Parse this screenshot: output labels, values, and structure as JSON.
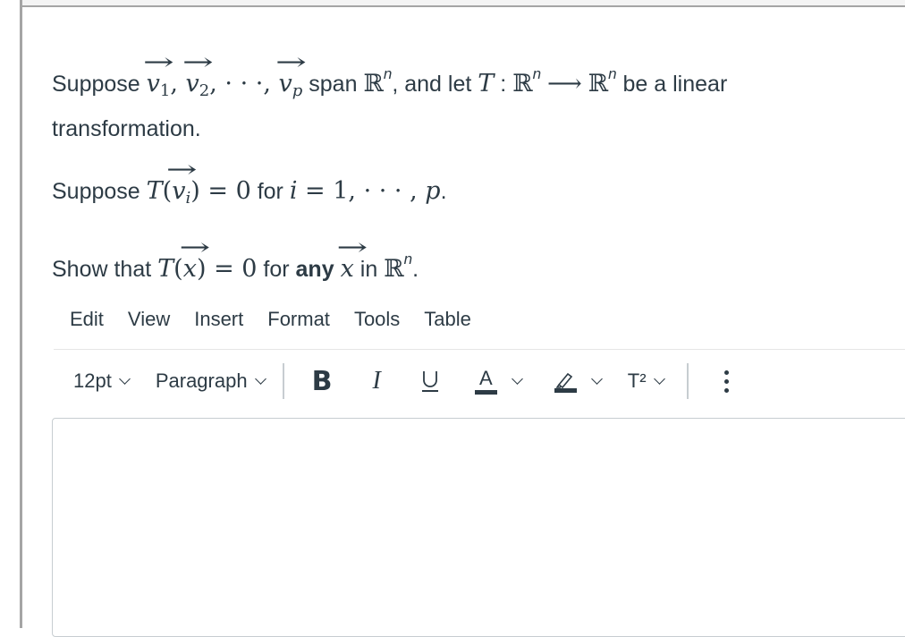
{
  "question": {
    "p1": {
      "t1": "Suppose ",
      "v": "v",
      "s1": "1",
      "s2": "2",
      "sp": "p",
      "comma": ", ",
      "dots": "· · ·",
      "t2": " span ",
      "R": "ℝ",
      "n": "n",
      "t3": ", and let ",
      "T": "T",
      "colon": " : ",
      "arrow": "⟶",
      "t4": " be a linear transformation."
    },
    "p2": {
      "t1": "Suppose ",
      "expr_eq": " = 0",
      "t2": " for ",
      "i": "i",
      "range": " = 1, · · · , ",
      "p": "p",
      "end": "."
    },
    "p3": {
      "t1": "Show that ",
      "x": "x",
      "t2": " for ",
      "any": "any",
      "t3": " in ",
      "end": "."
    }
  },
  "editor_menu": [
    "Edit",
    "View",
    "Insert",
    "Format",
    "Tools",
    "Table"
  ],
  "toolbar": {
    "font_size": "12pt",
    "block_format": "Paragraph",
    "bold": "B",
    "italic": "I",
    "underline": "U",
    "text_color": "A",
    "superscript": "T²"
  },
  "editor": {
    "content": ""
  },
  "colors": {
    "text": "#2d3b45",
    "border": "#c7cdd1",
    "rule": "#a5a5a5"
  }
}
